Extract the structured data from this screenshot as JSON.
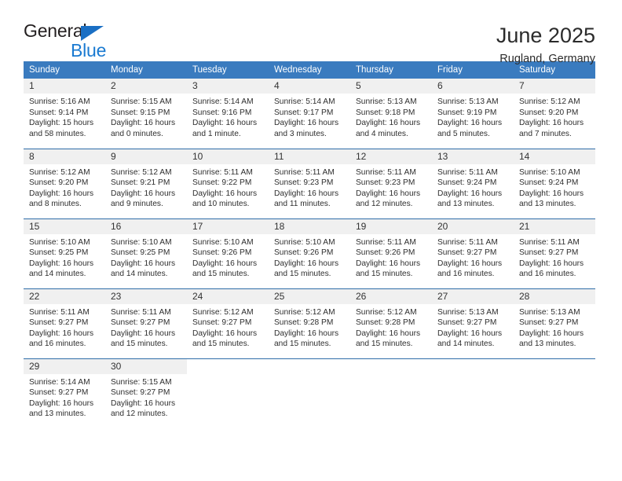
{
  "logo": {
    "word_top": "General",
    "word_bottom": "Blue",
    "triangle_color": "#1a6fc4",
    "blue_color": "#1a7ad1"
  },
  "header": {
    "title": "June 2025",
    "subtitle": "Rugland, Germany"
  },
  "theme": {
    "header_blue": "#3a7bbf",
    "row_divider_blue": "#2f6da8",
    "daynum_band": "#f0f0f0",
    "text": "#2e2e2e"
  },
  "calendar": {
    "weekday_headers": [
      "Sunday",
      "Monday",
      "Tuesday",
      "Wednesday",
      "Thursday",
      "Friday",
      "Saturday"
    ],
    "labels": {
      "sunrise": "Sunrise:",
      "sunset": "Sunset:",
      "daylight": "Daylight:"
    },
    "weeks": [
      [
        {
          "day": "1",
          "sunrise": "Sunrise: 5:16 AM",
          "sunset": "Sunset: 9:14 PM",
          "daylight": "Daylight: 15 hours and 58 minutes."
        },
        {
          "day": "2",
          "sunrise": "Sunrise: 5:15 AM",
          "sunset": "Sunset: 9:15 PM",
          "daylight": "Daylight: 16 hours and 0 minutes."
        },
        {
          "day": "3",
          "sunrise": "Sunrise: 5:14 AM",
          "sunset": "Sunset: 9:16 PM",
          "daylight": "Daylight: 16 hours and 1 minute."
        },
        {
          "day": "4",
          "sunrise": "Sunrise: 5:14 AM",
          "sunset": "Sunset: 9:17 PM",
          "daylight": "Daylight: 16 hours and 3 minutes."
        },
        {
          "day": "5",
          "sunrise": "Sunrise: 5:13 AM",
          "sunset": "Sunset: 9:18 PM",
          "daylight": "Daylight: 16 hours and 4 minutes."
        },
        {
          "day": "6",
          "sunrise": "Sunrise: 5:13 AM",
          "sunset": "Sunset: 9:19 PM",
          "daylight": "Daylight: 16 hours and 5 minutes."
        },
        {
          "day": "7",
          "sunrise": "Sunrise: 5:12 AM",
          "sunset": "Sunset: 9:20 PM",
          "daylight": "Daylight: 16 hours and 7 minutes."
        }
      ],
      [
        {
          "day": "8",
          "sunrise": "Sunrise: 5:12 AM",
          "sunset": "Sunset: 9:20 PM",
          "daylight": "Daylight: 16 hours and 8 minutes."
        },
        {
          "day": "9",
          "sunrise": "Sunrise: 5:12 AM",
          "sunset": "Sunset: 9:21 PM",
          "daylight": "Daylight: 16 hours and 9 minutes."
        },
        {
          "day": "10",
          "sunrise": "Sunrise: 5:11 AM",
          "sunset": "Sunset: 9:22 PM",
          "daylight": "Daylight: 16 hours and 10 minutes."
        },
        {
          "day": "11",
          "sunrise": "Sunrise: 5:11 AM",
          "sunset": "Sunset: 9:23 PM",
          "daylight": "Daylight: 16 hours and 11 minutes."
        },
        {
          "day": "12",
          "sunrise": "Sunrise: 5:11 AM",
          "sunset": "Sunset: 9:23 PM",
          "daylight": "Daylight: 16 hours and 12 minutes."
        },
        {
          "day": "13",
          "sunrise": "Sunrise: 5:11 AM",
          "sunset": "Sunset: 9:24 PM",
          "daylight": "Daylight: 16 hours and 13 minutes."
        },
        {
          "day": "14",
          "sunrise": "Sunrise: 5:10 AM",
          "sunset": "Sunset: 9:24 PM",
          "daylight": "Daylight: 16 hours and 13 minutes."
        }
      ],
      [
        {
          "day": "15",
          "sunrise": "Sunrise: 5:10 AM",
          "sunset": "Sunset: 9:25 PM",
          "daylight": "Daylight: 16 hours and 14 minutes."
        },
        {
          "day": "16",
          "sunrise": "Sunrise: 5:10 AM",
          "sunset": "Sunset: 9:25 PM",
          "daylight": "Daylight: 16 hours and 14 minutes."
        },
        {
          "day": "17",
          "sunrise": "Sunrise: 5:10 AM",
          "sunset": "Sunset: 9:26 PM",
          "daylight": "Daylight: 16 hours and 15 minutes."
        },
        {
          "day": "18",
          "sunrise": "Sunrise: 5:10 AM",
          "sunset": "Sunset: 9:26 PM",
          "daylight": "Daylight: 16 hours and 15 minutes."
        },
        {
          "day": "19",
          "sunrise": "Sunrise: 5:11 AM",
          "sunset": "Sunset: 9:26 PM",
          "daylight": "Daylight: 16 hours and 15 minutes."
        },
        {
          "day": "20",
          "sunrise": "Sunrise: 5:11 AM",
          "sunset": "Sunset: 9:27 PM",
          "daylight": "Daylight: 16 hours and 16 minutes."
        },
        {
          "day": "21",
          "sunrise": "Sunrise: 5:11 AM",
          "sunset": "Sunset: 9:27 PM",
          "daylight": "Daylight: 16 hours and 16 minutes."
        }
      ],
      [
        {
          "day": "22",
          "sunrise": "Sunrise: 5:11 AM",
          "sunset": "Sunset: 9:27 PM",
          "daylight": "Daylight: 16 hours and 16 minutes."
        },
        {
          "day": "23",
          "sunrise": "Sunrise: 5:11 AM",
          "sunset": "Sunset: 9:27 PM",
          "daylight": "Daylight: 16 hours and 15 minutes."
        },
        {
          "day": "24",
          "sunrise": "Sunrise: 5:12 AM",
          "sunset": "Sunset: 9:27 PM",
          "daylight": "Daylight: 16 hours and 15 minutes."
        },
        {
          "day": "25",
          "sunrise": "Sunrise: 5:12 AM",
          "sunset": "Sunset: 9:28 PM",
          "daylight": "Daylight: 16 hours and 15 minutes."
        },
        {
          "day": "26",
          "sunrise": "Sunrise: 5:12 AM",
          "sunset": "Sunset: 9:28 PM",
          "daylight": "Daylight: 16 hours and 15 minutes."
        },
        {
          "day": "27",
          "sunrise": "Sunrise: 5:13 AM",
          "sunset": "Sunset: 9:27 PM",
          "daylight": "Daylight: 16 hours and 14 minutes."
        },
        {
          "day": "28",
          "sunrise": "Sunrise: 5:13 AM",
          "sunset": "Sunset: 9:27 PM",
          "daylight": "Daylight: 16 hours and 13 minutes."
        }
      ],
      [
        {
          "day": "29",
          "sunrise": "Sunrise: 5:14 AM",
          "sunset": "Sunset: 9:27 PM",
          "daylight": "Daylight: 16 hours and 13 minutes."
        },
        {
          "day": "30",
          "sunrise": "Sunrise: 5:15 AM",
          "sunset": "Sunset: 9:27 PM",
          "daylight": "Daylight: 16 hours and 12 minutes."
        },
        {
          "day": "",
          "sunrise": "",
          "sunset": "",
          "daylight": ""
        },
        {
          "day": "",
          "sunrise": "",
          "sunset": "",
          "daylight": ""
        },
        {
          "day": "",
          "sunrise": "",
          "sunset": "",
          "daylight": ""
        },
        {
          "day": "",
          "sunrise": "",
          "sunset": "",
          "daylight": ""
        },
        {
          "day": "",
          "sunrise": "",
          "sunset": "",
          "daylight": ""
        }
      ]
    ]
  }
}
